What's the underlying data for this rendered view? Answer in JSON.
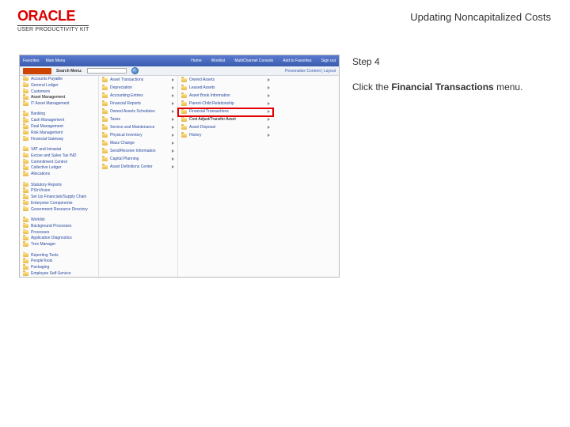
{
  "header": {
    "brand": "ORACLE",
    "brand_sub": "USER PRODUCTIVITY KIT",
    "title": "Updating Noncapitalized Costs"
  },
  "instruction": {
    "step_label": "Step 4",
    "text_prefix": "Click the ",
    "text_bold": "Financial Transactions",
    "text_suffix": " menu."
  },
  "screenshot": {
    "topbar_left": [
      "Favorites",
      "Main Menu"
    ],
    "topbar_right": [
      "Home",
      "Worklist",
      "MultiChannel Console",
      "Add to Favorites",
      "Sign out"
    ],
    "search_label": "Search Menu:",
    "personalize": "Personalize Content | Layout",
    "col1_header": "",
    "col1_items": [
      "Accounts Payable",
      "General Ledger",
      "Customers",
      "Asset Management",
      "IT Asset Management",
      "Banking",
      "Cash Management",
      "Deal Management",
      "Risk Management",
      "Financial Gateway",
      "VAT and Intrastat",
      "Excise and Sales Tax IND",
      "Commitment Control",
      "Collective Ledger",
      "Allocations",
      "Statutory Reports",
      "PS/nVision",
      "Set Up Financials/Supply Chain",
      "Enterprise Components",
      "Government Resource Directory",
      "Worklist",
      "Background Processes",
      "Processes",
      "Application Diagnostics",
      "Tree Manager",
      "Reporting Tools",
      "PeopleTools",
      "Packaging",
      "Employee Self-Service"
    ],
    "col2_items": [
      "Asset Transactions",
      "Depreciation",
      "Accounting Entries",
      "Financial Reports",
      "Owned Assets Schedules",
      "Taxes",
      "Service and Maintenance",
      "Physical Inventory",
      "Mass Change",
      "Send/Receive Information",
      "Capital Planning",
      "Asset Definitions Center"
    ],
    "col3_items": [
      "Owned Assets",
      "Leased Assets",
      "Asset Book Information",
      "Parent-Child Relationship",
      "Financial Transactions",
      "Cost Adjust/Transfer Asset",
      "Asset Disposal",
      "History"
    ],
    "highlighted_index": 5
  }
}
